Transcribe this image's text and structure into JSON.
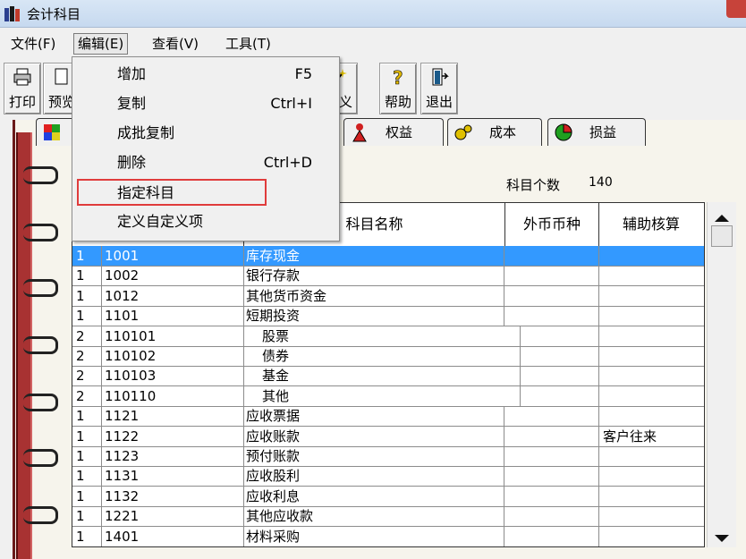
{
  "window": {
    "title": "会计科目"
  },
  "menubar": [
    "文件(F)",
    "编辑(E)",
    "查看(V)",
    "工具(T)"
  ],
  "toolbar": {
    "print": "打印",
    "preview": "预览",
    "define": "定义",
    "help": "帮助",
    "exit": "退出"
  },
  "tabs": {
    "equity": "权益",
    "cost": "成本",
    "profit_loss": "损益"
  },
  "summary": {
    "count_label": "科目个数",
    "count_value": "140"
  },
  "grid": {
    "headers": {
      "name": "科目名称",
      "currency": "外币币种",
      "aux": "辅助核算"
    },
    "rows": [
      {
        "level": "1",
        "code": "1001",
        "name": "库存现金",
        "aux": ""
      },
      {
        "level": "1",
        "code": "1002",
        "name": "银行存款",
        "aux": ""
      },
      {
        "level": "1",
        "code": "1012",
        "name": "其他货币资金",
        "aux": ""
      },
      {
        "level": "1",
        "code": "1101",
        "name": "短期投资",
        "aux": ""
      },
      {
        "level": "2",
        "code": "110101",
        "name": "股票",
        "aux": ""
      },
      {
        "level": "2",
        "code": "110102",
        "name": "债券",
        "aux": ""
      },
      {
        "level": "2",
        "code": "110103",
        "name": "基金",
        "aux": ""
      },
      {
        "level": "2",
        "code": "110110",
        "name": "其他",
        "aux": ""
      },
      {
        "level": "1",
        "code": "1121",
        "name": "应收票据",
        "aux": ""
      },
      {
        "level": "1",
        "code": "1122",
        "name": "应收账款",
        "aux": "客户往来"
      },
      {
        "level": "1",
        "code": "1123",
        "name": "预付账款",
        "aux": ""
      },
      {
        "level": "1",
        "code": "1131",
        "name": "应收股利",
        "aux": ""
      },
      {
        "level": "1",
        "code": "1132",
        "name": "应收利息",
        "aux": ""
      },
      {
        "level": "1",
        "code": "1221",
        "name": "其他应收款",
        "aux": ""
      },
      {
        "level": "1",
        "code": "1401",
        "name": "材料采购",
        "aux": ""
      }
    ]
  },
  "edit_menu": {
    "items": [
      {
        "label": "增加",
        "shortcut": "F5"
      },
      {
        "label": "复制",
        "shortcut": "Ctrl+I"
      },
      {
        "label": "成批复制",
        "shortcut": ""
      },
      {
        "label": "删除",
        "shortcut": "Ctrl+D"
      },
      {
        "label": "指定科目",
        "shortcut": ""
      },
      {
        "label": "定义自定义项",
        "shortcut": ""
      }
    ]
  },
  "colors": {
    "selection": "#3399ff",
    "highlight_box": "#e03c3c",
    "spine": "#a83232"
  }
}
